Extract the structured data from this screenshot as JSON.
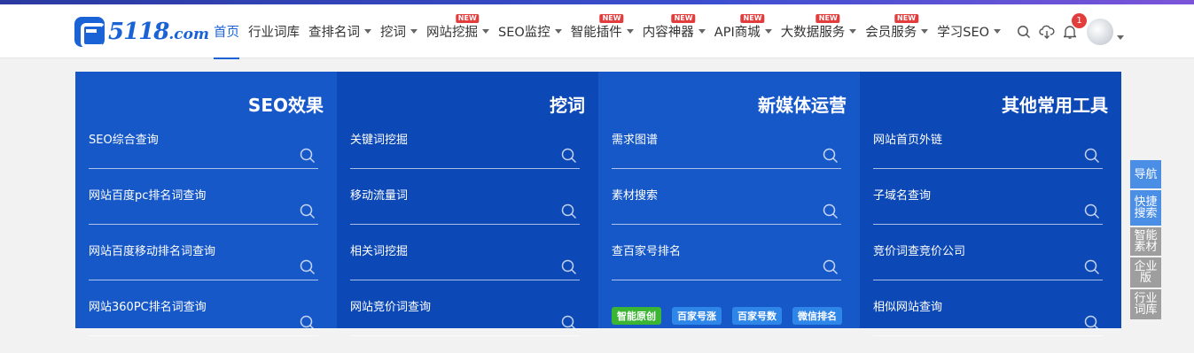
{
  "logo": {
    "text": "5118",
    "suffix": ".com"
  },
  "nav": [
    {
      "label": "首页",
      "active": true,
      "caret": false,
      "badge": ""
    },
    {
      "label": "行业词库",
      "caret": false,
      "badge": ""
    },
    {
      "label": "查排名词",
      "caret": true,
      "badge": ""
    },
    {
      "label": "挖词",
      "caret": true,
      "badge": ""
    },
    {
      "label": "网站挖掘",
      "caret": true,
      "badge": "NEW"
    },
    {
      "label": "SEO监控",
      "caret": true,
      "badge": ""
    },
    {
      "label": "智能插件",
      "caret": true,
      "badge": "NEW"
    },
    {
      "label": "内容神器",
      "caret": true,
      "badge": "NEW"
    },
    {
      "label": "API商城",
      "caret": true,
      "badge": "NEW"
    },
    {
      "label": "大数据服务",
      "caret": true,
      "badge": "NEW"
    },
    {
      "label": "会员服务",
      "caret": true,
      "badge": "NEW"
    },
    {
      "label": "学习SEO",
      "caret": true,
      "badge": ""
    }
  ],
  "header_icons": {
    "notifications_count": "1"
  },
  "columns": [
    {
      "title": "SEO效果",
      "bg": "#1758c9",
      "fields": [
        "SEO综合查询",
        "网站百度pc排名词查询",
        "网站百度移动排名词查询",
        "网站360PC排名词查询"
      ]
    },
    {
      "title": "挖词",
      "bg": "#0d49b6",
      "fields": [
        "关键词挖掘",
        "移动流量词",
        "相关词挖掘",
        "网站竞价词查询"
      ]
    },
    {
      "title": "新媒体运营",
      "bg": "#1758c9",
      "fields": [
        "需求图谱",
        "素材搜索",
        "查百家号排名"
      ],
      "tags": [
        "智能原创",
        "百家号涨",
        "百家号数",
        "微信排名"
      ]
    },
    {
      "title": "其他常用工具",
      "bg": "#0d49b6",
      "fields": [
        "网站首页外链",
        "子域名查询",
        "竞价词查竞价公司",
        "相似网站查询"
      ]
    }
  ],
  "side_tabs": [
    {
      "label": "导航",
      "color": "#4a8ee6"
    },
    {
      "label": "快捷搜索",
      "color": "#4a8ee6"
    },
    {
      "label": "智能素材",
      "color": "#9e9e9e"
    },
    {
      "label": "企业版",
      "color": "#9e9e9e"
    },
    {
      "label": "行业词库",
      "color": "#9e9e9e"
    }
  ]
}
